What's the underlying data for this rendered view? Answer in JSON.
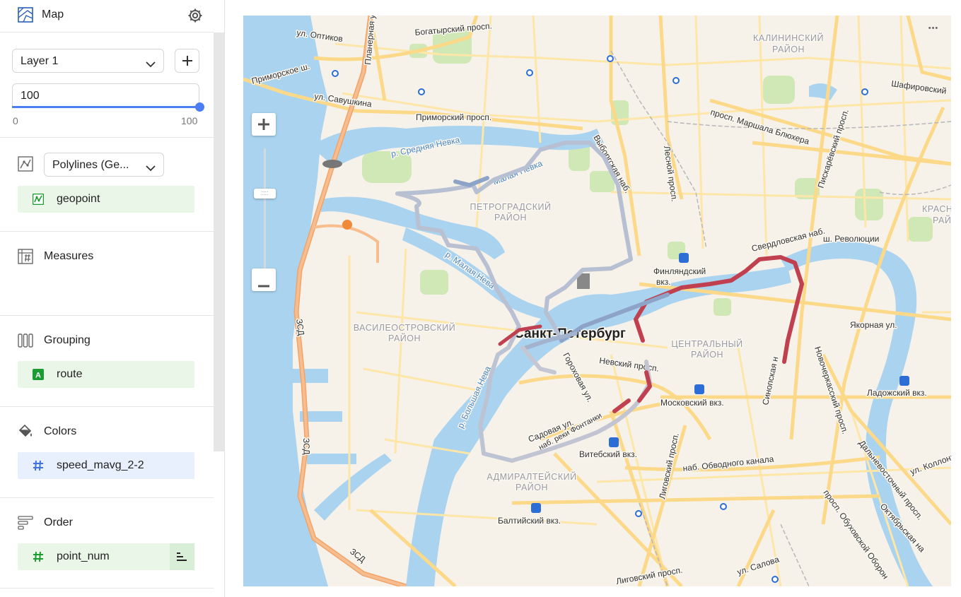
{
  "header": {
    "title": "Map",
    "map_icon": "map-icon",
    "settings_icon": "gear-icon"
  },
  "layer": {
    "select_value": "Layer 1",
    "add_icon": "plus-icon",
    "opacity_value": "100",
    "opacity_level": 1.0,
    "range_min": "0",
    "range_max": "100"
  },
  "geometry": {
    "type_value": "Polylines (Ge...",
    "field": {
      "label": "geopoint",
      "icon": "geo-field-icon"
    }
  },
  "measures": {
    "title": "Measures",
    "icon": "measures-icon"
  },
  "grouping": {
    "title": "Grouping",
    "icon": "grouping-icon",
    "field": {
      "label": "route",
      "icon": "text-field-icon",
      "icon_text": "A"
    }
  },
  "colors": {
    "title": "Colors",
    "icon": "paint-bucket-icon",
    "field": {
      "label": "speed_mavg_2-2",
      "icon": "number-field-icon",
      "icon_text": "#"
    }
  },
  "order": {
    "title": "Order",
    "icon": "order-icon",
    "field": {
      "label": "point_num",
      "icon": "number-field-icon",
      "icon_text": "#",
      "sort_icon": "sort-icon"
    }
  },
  "map": {
    "zoom_in_label": "+",
    "zoom_out_label": "−",
    "more_label": "•••",
    "labels": {
      "ul_optikov": "ул. Оптиков",
      "planernaya": "Планерная ул.",
      "bogatyrsky": "Богатырский просп.",
      "kalininsky1": "КАЛИНИНСКИЙ",
      "kalininsky2": "РАЙОН",
      "primorskoe": "Приморское ш.",
      "savushkina": "ул. Савушкина",
      "primorsky_pr": "Приморский просп.",
      "shafirovsky": "Шафировский",
      "sredn_neva": "р. Средняя Невка",
      "malaya_nevka": "Малая Невка",
      "vyborgskaya": "Выборгская наб.",
      "lesnoy": "Лесной просп.",
      "bluhera": "просп. Маршала Блюхера",
      "piskarev": "Пискарёвский просп.",
      "krasnogv1": "КРАСНОГВА",
      "krasnogv2": "РАЙОН",
      "petrograd1": "ПЕТРОГРАДСКИЙ",
      "petrograd2": "РАЙОН",
      "sverdlov": "Свердловская наб.",
      "revolution": "ш. Революции",
      "malaya_neva": "р. Малая Нева",
      "finland": "Финляндский",
      "finland2": "вкз.",
      "vasil1": "ВАСИЛЕОСТРОВСКИЙ",
      "vasil2": "РАЙОН",
      "spb": "Санкт-Петербург",
      "central1": "ЦЕНТРАЛЬНЫЙ",
      "central2": "РАЙОН",
      "yakornaya": "Якорная ул.",
      "zsd1": "ЗСД",
      "zsd2": "ЗСД",
      "zsd3": "ЗСД",
      "bolshaya_neva": "р. Большая Нева",
      "gorokhovaya": "Гороховая ул.",
      "nevsky": "Невский просп.",
      "sinopskaya": "Синопская н",
      "novocherk": "Новочеркасский просп.",
      "ladozhsky": "Ладожский вкз.",
      "moskovsky": "Московский вкз.",
      "sadovaya": "Садовая ул.",
      "fontanka": "наб. реки Фонтанки",
      "vitebsky": "Витебский вкз.",
      "ligovsky": "Лиговский просп.",
      "obvodny": "наб. Обводного канала",
      "dalnevost": "Дальневосточный просп.",
      "kollontai": "ул. Коллонт",
      "admiral1": "АДМИРАЛТЕЙСКИЙ",
      "admiral2": "РАЙОН",
      "baltiysky": "Балтийский вкз.",
      "obukhov": "просп. Обуховской Оборон",
      "oktyabr": "Октябрьская на",
      "ligovsky2": "Лиговский просп.",
      "salova": "ул. Салова"
    }
  },
  "colors_palette": {
    "route_low": "#b8c0d2",
    "route_mid": "#8ea3c8",
    "route_high": "#c0404f",
    "water": "#a9d3ef",
    "park": "#cfe8b6",
    "land": "#f6f2ea",
    "road": "#fcd989",
    "highway": "#f7b27a",
    "accent": "#4b7ef2"
  }
}
